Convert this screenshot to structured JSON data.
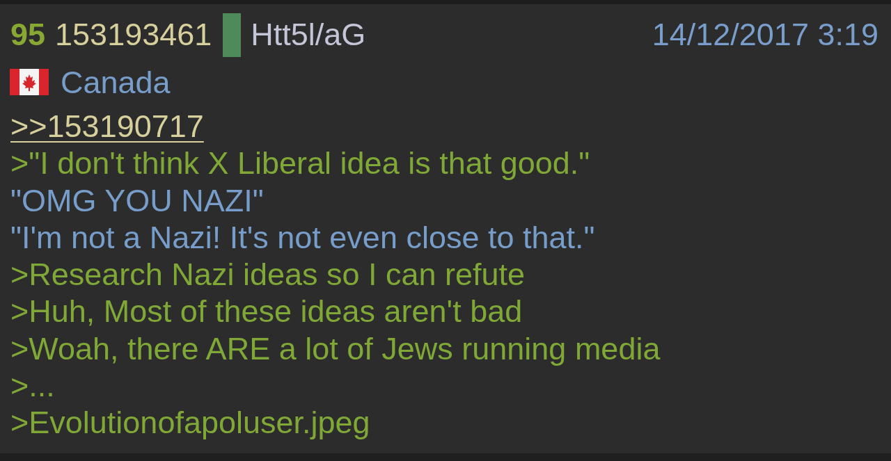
{
  "post": {
    "index": "95",
    "number": "153193461",
    "poster_id": {
      "text": "Htt5l/aG",
      "color": "#4f8a5a"
    },
    "date": "14/12/2017 3:19",
    "country": "Canada",
    "body": [
      {
        "kind": "reply_link",
        "text": ">>153190717"
      },
      {
        "kind": "greentext",
        "text": ">\"I don't think X Liberal idea is that good.\""
      },
      {
        "kind": "plain",
        "text": "\"OMG YOU NAZI\""
      },
      {
        "kind": "plain",
        "text": "\"I'm not a Nazi! It's not even close to that.\""
      },
      {
        "kind": "greentext",
        "text": ">Research Nazi ideas so I can refute"
      },
      {
        "kind": "greentext",
        "text": ">Huh, Most of these ideas aren't bad"
      },
      {
        "kind": "greentext",
        "text": ">Woah, there ARE a lot of Jews running media"
      },
      {
        "kind": "greentext",
        "text": ">..."
      },
      {
        "kind": "greentext",
        "text": ">Evolutionofapoluser.jpeg"
      }
    ]
  }
}
